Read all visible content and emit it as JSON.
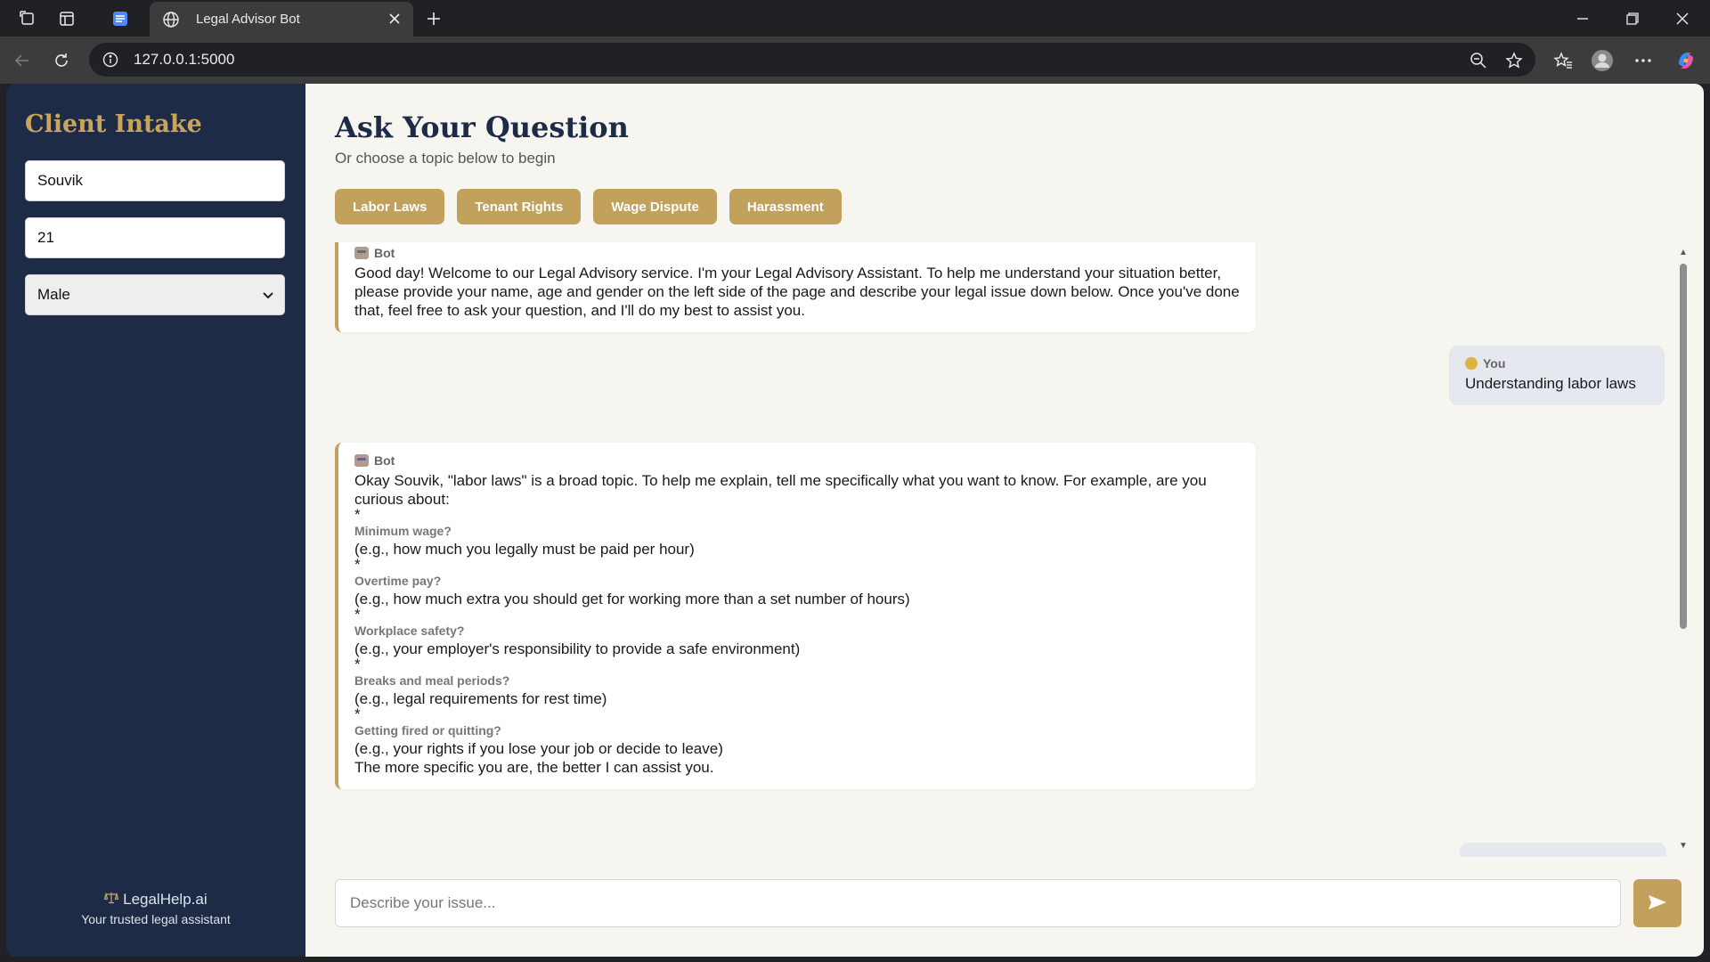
{
  "browser": {
    "tab_title": "Legal Advisor Bot",
    "url": "127.0.0.1:5000"
  },
  "sidebar": {
    "title": "Client Intake",
    "name_value": "Souvik",
    "age_value": "21",
    "gender_value": "Male",
    "brand_name": "LegalHelp.ai",
    "brand_tagline": "Your trusted legal assistant"
  },
  "main": {
    "title": "Ask Your Question",
    "subtitle": "Or choose a topic below to begin",
    "topics": [
      "Labor Laws",
      "Tenant Rights",
      "Wage Dispute",
      "Harassment"
    ]
  },
  "chat": {
    "bot_label": "Bot",
    "you_label": "You",
    "msg1": "Good day! Welcome to our Legal Advisory service. I'm your Legal Advisory Assistant. To help me understand your situation better, please provide your name, age and gender on the left side of the page and describe your legal issue down below. Once you've done that, feel free to ask your question, and I'll do my best to assist you.",
    "msg2": "Understanding labor laws",
    "msg3_intro": "Okay Souvik, \"labor laws\" is a broad topic. To help me explain, tell me specifically what you want to know. For example, are you curious about:",
    "msg3_items": [
      {
        "bullet": "*",
        "head": "Minimum wage?",
        "desc": "(e.g., how much you legally must be paid per hour)"
      },
      {
        "bullet": "*",
        "head": "Overtime pay?",
        "desc": "(e.g., how much extra you should get for working more than a set number of hours)"
      },
      {
        "bullet": "*",
        "head": "Workplace safety?",
        "desc": "(e.g., your employer's responsibility to provide a safe environment)"
      },
      {
        "bullet": "*",
        "head": "Breaks and meal periods?",
        "desc": "(e.g., legal requirements for rest time)"
      },
      {
        "bullet": "*",
        "head": "Getting fired or quitting?",
        "desc": "(e.g., your rights if you lose your job or decide to leave)"
      }
    ],
    "msg3_outro": "The more specific you are, the better I can assist you."
  },
  "composer": {
    "placeholder": "Describe your issue..."
  },
  "icons": {
    "brand_icon": "scales-icon",
    "send_icon": "send-arrow-icon"
  },
  "colors": {
    "sidebar_bg": "#1e2b47",
    "accent_gold": "#c1a15b",
    "main_bg": "#f7f5ef"
  }
}
